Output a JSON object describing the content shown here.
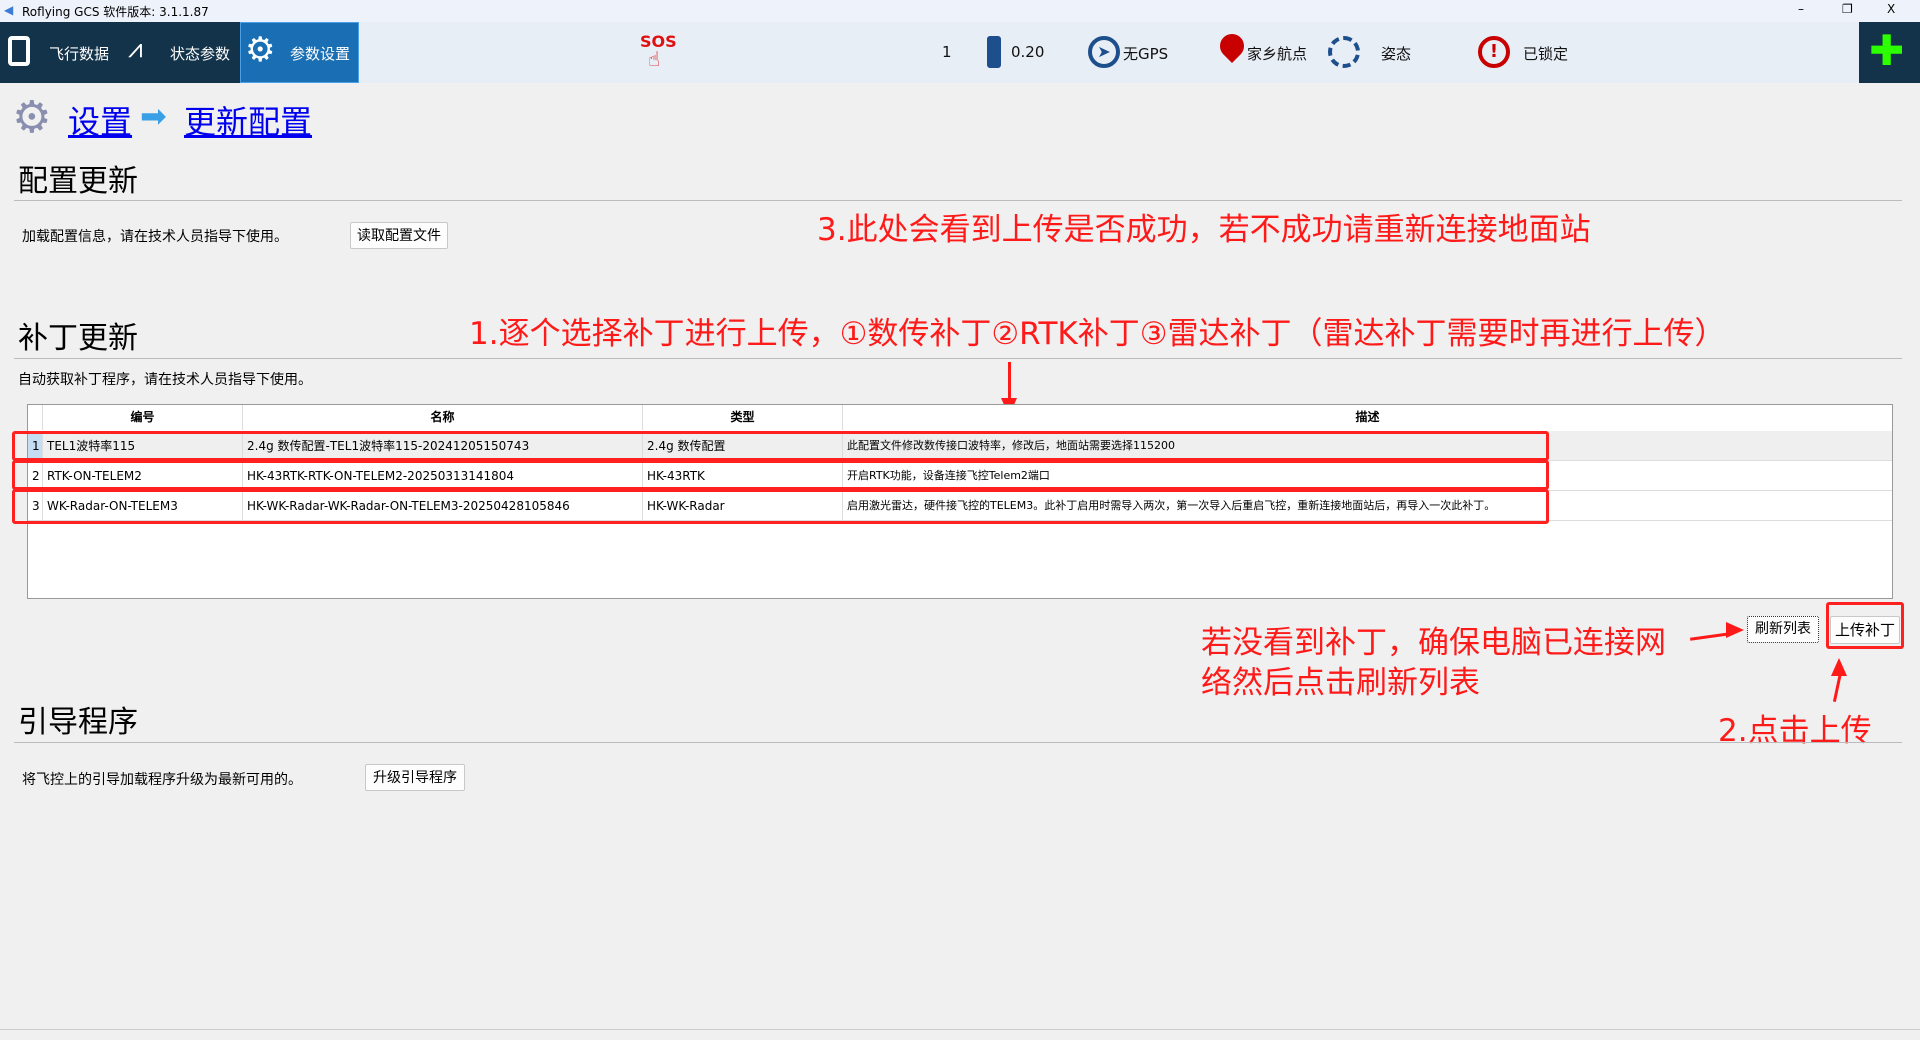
{
  "window": {
    "title": "Roflying GCS 软件版本: 3.1.1.87",
    "min": "–",
    "max": "❐",
    "close": "X"
  },
  "toolbar": {
    "tabs": [
      {
        "label": "飞行数据"
      },
      {
        "label": "状态参数"
      },
      {
        "label": "参数设置"
      }
    ],
    "sos": "SOS",
    "count": "1",
    "battery": "0.20",
    "gps": "无GPS",
    "home": "家乡航点",
    "attitude": "姿态",
    "lock": "已锁定"
  },
  "breadcrumb": {
    "root": "设置",
    "current": "更新配置"
  },
  "config": {
    "title": "配置更新",
    "desc": "加载配置信息，请在技术人员指导下使用。",
    "button": "读取配置文件"
  },
  "patch": {
    "title": "补丁更新",
    "desc": "自动获取补丁程序，请在技术人员指导下使用。",
    "columns": [
      "编号",
      "名称",
      "类型",
      "描述"
    ],
    "rows": [
      {
        "n": "1",
        "id": "TEL1波特率115",
        "name": "2.4g 数传配置-TEL1波特率115-20241205150743",
        "type": "2.4g 数传配置",
        "desc": "此配置文件修改数传接口波特率，修改后，地面站需要选择115200"
      },
      {
        "n": "2",
        "id": "RTK-ON-TELEM2",
        "name": "HK-43RTK-RTK-ON-TELEM2-20250313141804",
        "type": "HK-43RTK",
        "desc": "开启RTK功能，设备连接飞控Telem2端口"
      },
      {
        "n": "3",
        "id": "WK-Radar-ON-TELEM3",
        "name": "HK-WK-Radar-WK-Radar-ON-TELEM3-20250428105846",
        "type": "HK-WK-Radar",
        "desc": "启用激光雷达，硬件接飞控的TELEM3。此补丁启用时需导入两次，第一次导入后重启飞控，重新连接地面站后，再导入一次此补丁。"
      }
    ],
    "refresh": "刷新列表",
    "upload": "上传补丁"
  },
  "boot": {
    "title": "引导程序",
    "desc": "将飞控上的引导加载程序升级为最新可用的。",
    "button": "升级引导程序"
  },
  "annotations": {
    "a1": "1.逐个选择补丁进行上传，①数传补丁②RTK补丁③雷达补丁（雷达补丁需要时再进行上传）",
    "a2": "2.点击上传",
    "a3": "3.此处会看到上传是否成功，若不成功请重新连接地面站",
    "a4_line1": "若没看到补丁，确保电脑已连接网",
    "a4_line2": "络然后点击刷新列表"
  },
  "colors": {
    "accent": "#1a6fb4",
    "annotation": "#ff1a1a",
    "dark": "#13334a"
  }
}
